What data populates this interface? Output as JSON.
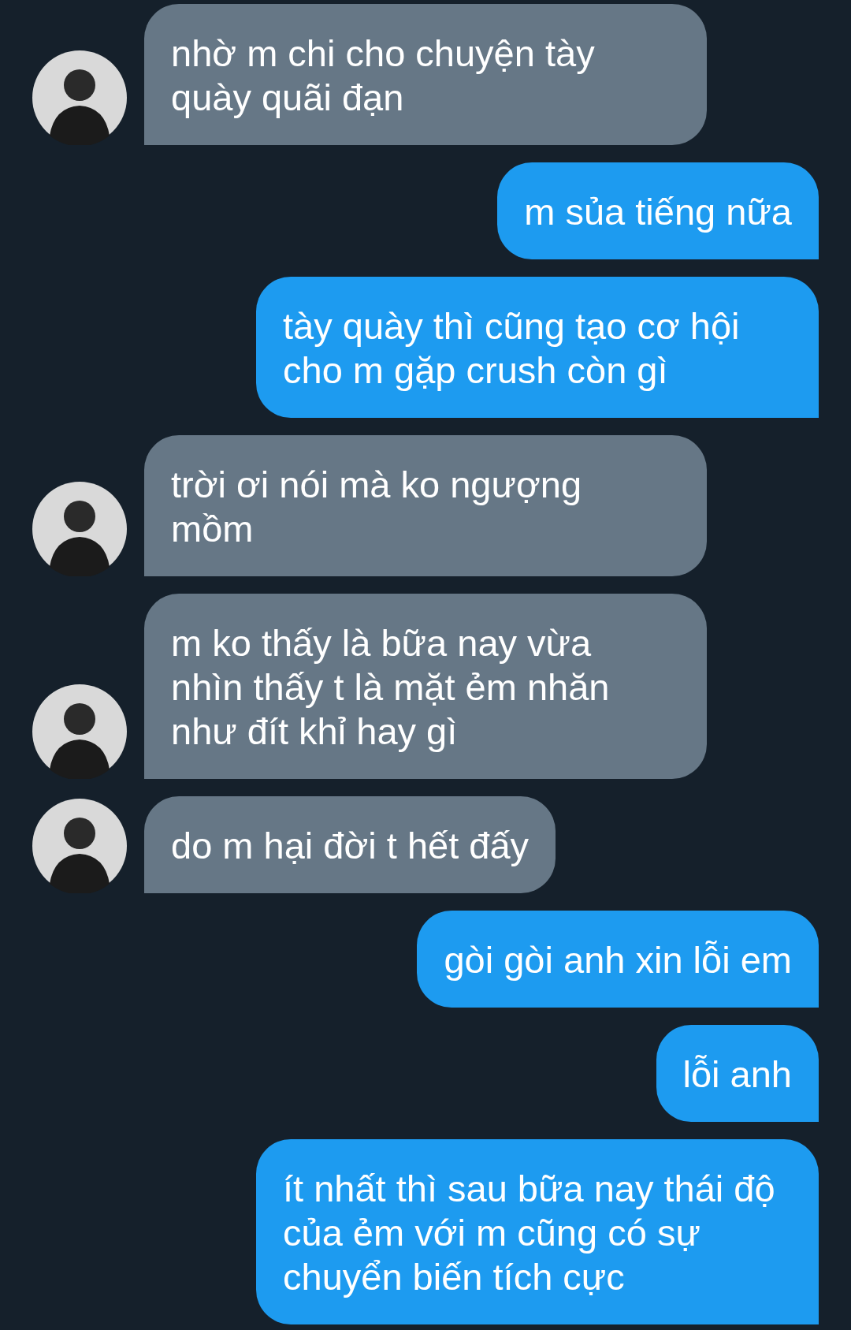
{
  "messages": [
    {
      "kind": "them",
      "text": "nhờ m chi cho chuyện tày\nquày quãi đạn"
    },
    {
      "kind": "me",
      "text": "m sủa tiếng nữa"
    },
    {
      "kind": "me",
      "text": "tày quày thì cũng tạo cơ hội\ncho m gặp crush còn gì"
    },
    {
      "kind": "them",
      "text": "trời ơi nói mà ko ngượng\nmồm"
    },
    {
      "kind": "them",
      "text": "m ko thấy là bữa nay vừa\nnhìn thấy t là mặt ẻm nhăn\nnhư đít khỉ hay gì"
    },
    {
      "kind": "them",
      "text": "do m hại đời t hết đấy"
    },
    {
      "kind": "me",
      "text": "gòi gòi anh xin lỗi em"
    },
    {
      "kind": "me",
      "text": "lỗi anh"
    },
    {
      "kind": "me",
      "text": "ít nhất thì sau bữa nay thái độ\ncủa ẻm với m cũng có sự\nchuyển biến tích cực"
    }
  ]
}
